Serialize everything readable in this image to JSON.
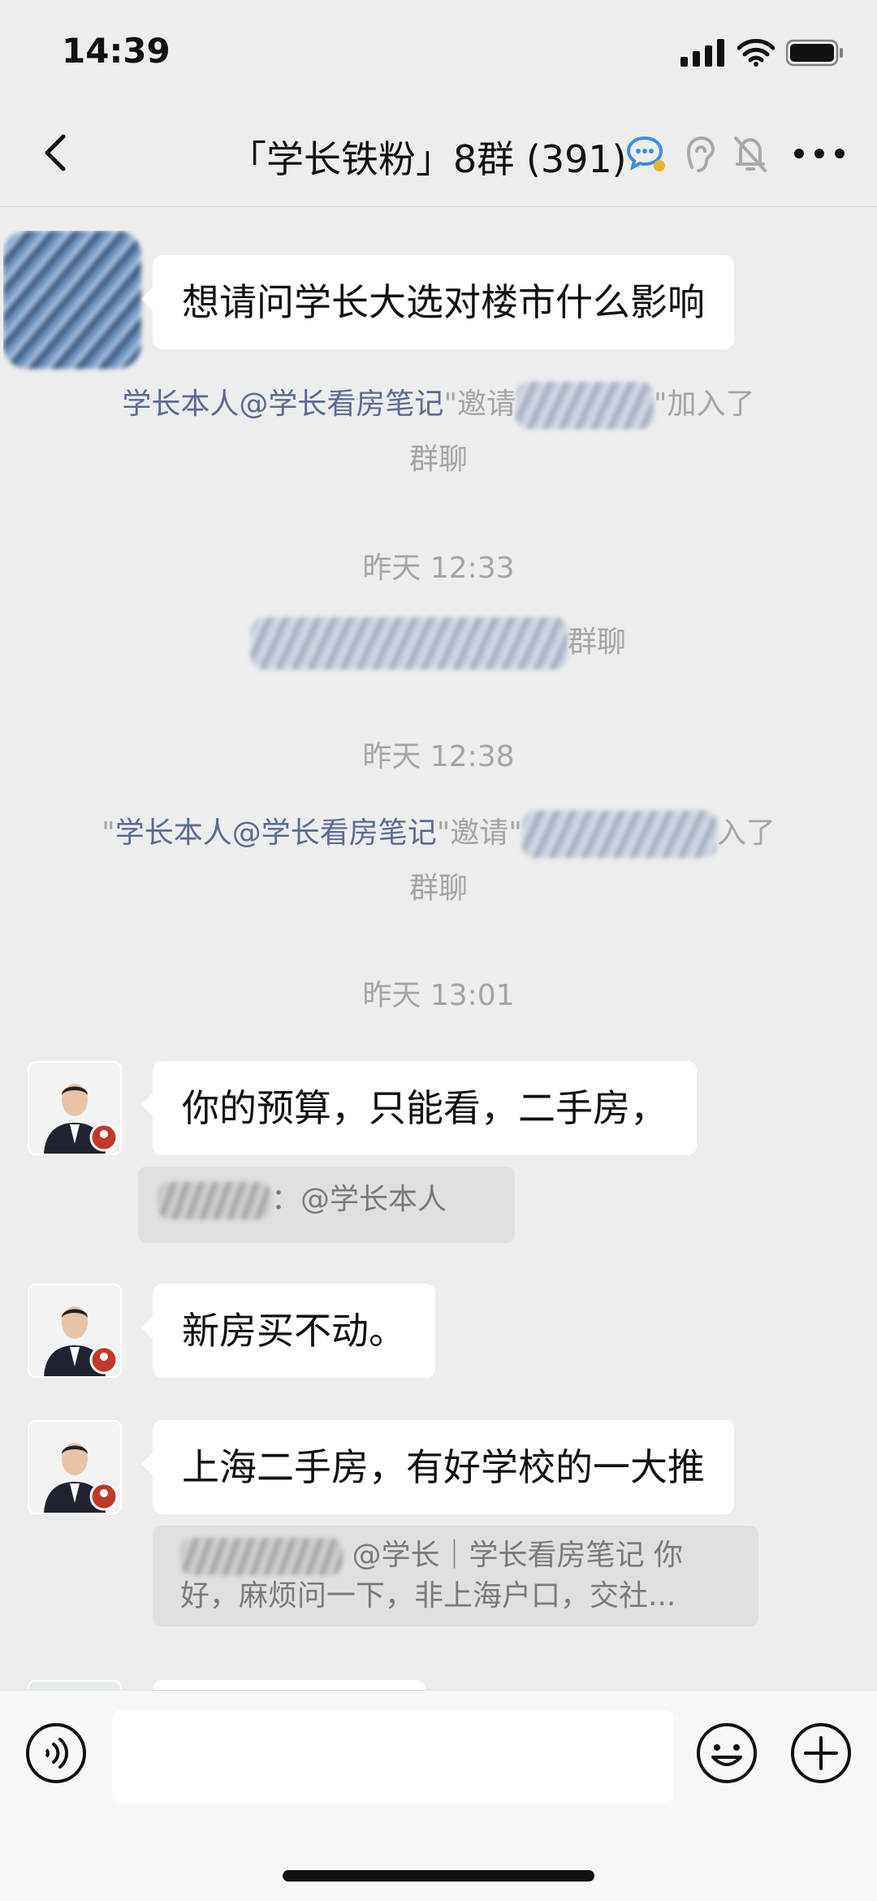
{
  "status_bar": {
    "time": "14:39"
  },
  "nav": {
    "title": "「学长铁粉」8群 (391)",
    "icons": [
      "back-icon",
      "chat-bubble-icon",
      "ear-icon",
      "bell-muted-icon",
      "more-icon"
    ]
  },
  "messages": [
    {
      "type": "text",
      "text": "想请问学长大选对楼市什么影响"
    },
    {
      "type": "system",
      "link_text": "学长本人@学长看房笔记",
      "mid": "\"邀请",
      "end": "\"加入了",
      "line2": "群聊"
    },
    {
      "type": "time",
      "text": "昨天 12:33"
    },
    {
      "type": "system_blur",
      "end": "群聊"
    },
    {
      "type": "time",
      "text": "昨天 12:38"
    },
    {
      "type": "system",
      "prefix": "\"",
      "link_text": "学长本人@学长看房笔记",
      "mid": "\"邀请\"",
      "end": "入了",
      "line2": "群聊"
    },
    {
      "type": "time",
      "text": "昨天 13:01"
    },
    {
      "type": "text",
      "text": "你的预算，只能看，二手房，",
      "quote": "：@学长本人"
    },
    {
      "type": "text",
      "text": "新房买不动。"
    },
    {
      "type": "text",
      "text": "上海二手房，有好学校的一大推",
      "quote_line1": "@学长｜学长看房笔记 你",
      "quote_line2": "好，麻烦问一下，非上海户口，交社..."
    }
  ],
  "input_bar": {
    "icons": [
      "voice-icon",
      "emoji-icon",
      "plus-icon"
    ],
    "text_value": ""
  },
  "colors": {
    "background": "#ededed",
    "bubble": "#ffffff",
    "link": "#5b6b91",
    "system_text": "#a5a5a5"
  }
}
